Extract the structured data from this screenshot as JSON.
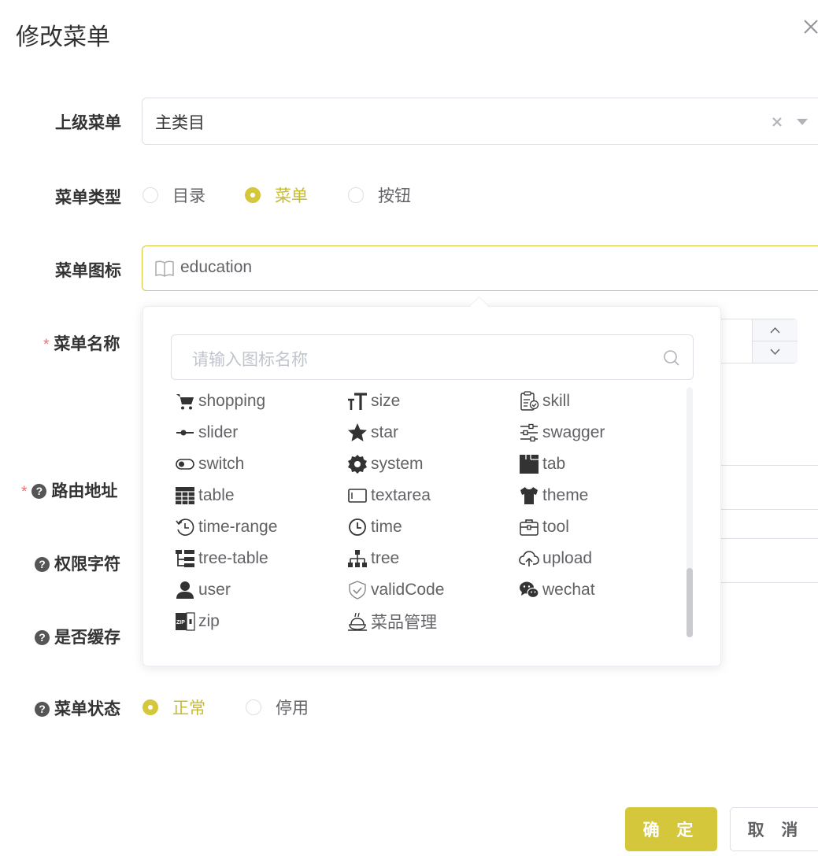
{
  "dialog": {
    "title": "修改菜单"
  },
  "form": {
    "parent": {
      "label": "上级菜单",
      "value": "主类目"
    },
    "type": {
      "label": "菜单类型",
      "options": [
        "目录",
        "菜单",
        "按钮"
      ],
      "selected": "菜单"
    },
    "icon": {
      "label": "菜单图标",
      "value": "education"
    },
    "name": {
      "label": "菜单名称",
      "required_mark": "*"
    },
    "path": {
      "label": "路由地址",
      "required_mark": "*"
    },
    "perms": {
      "label": "权限字符"
    },
    "cache": {
      "label": "是否缓存"
    },
    "status": {
      "label": "菜单状态",
      "options": [
        "正常",
        "停用"
      ],
      "selected": "正常"
    }
  },
  "icon_picker": {
    "search_placeholder": "请输入图标名称",
    "items": [
      [
        "shopping",
        "size",
        "skill"
      ],
      [
        "slider",
        "star",
        "swagger"
      ],
      [
        "switch",
        "system",
        "tab"
      ],
      [
        "table",
        "textarea",
        "theme"
      ],
      [
        "time-range",
        "time",
        "tool"
      ],
      [
        "tree-table",
        "tree",
        "upload"
      ],
      [
        "user",
        "validCode",
        "wechat"
      ],
      [
        "zip",
        "菜品管理"
      ]
    ]
  },
  "footer": {
    "ok_label": "确 定",
    "cancel_label": "取 消"
  },
  "colors": {
    "accent": "#d4c73c",
    "required": "#f56c6c",
    "label": "#333333"
  }
}
